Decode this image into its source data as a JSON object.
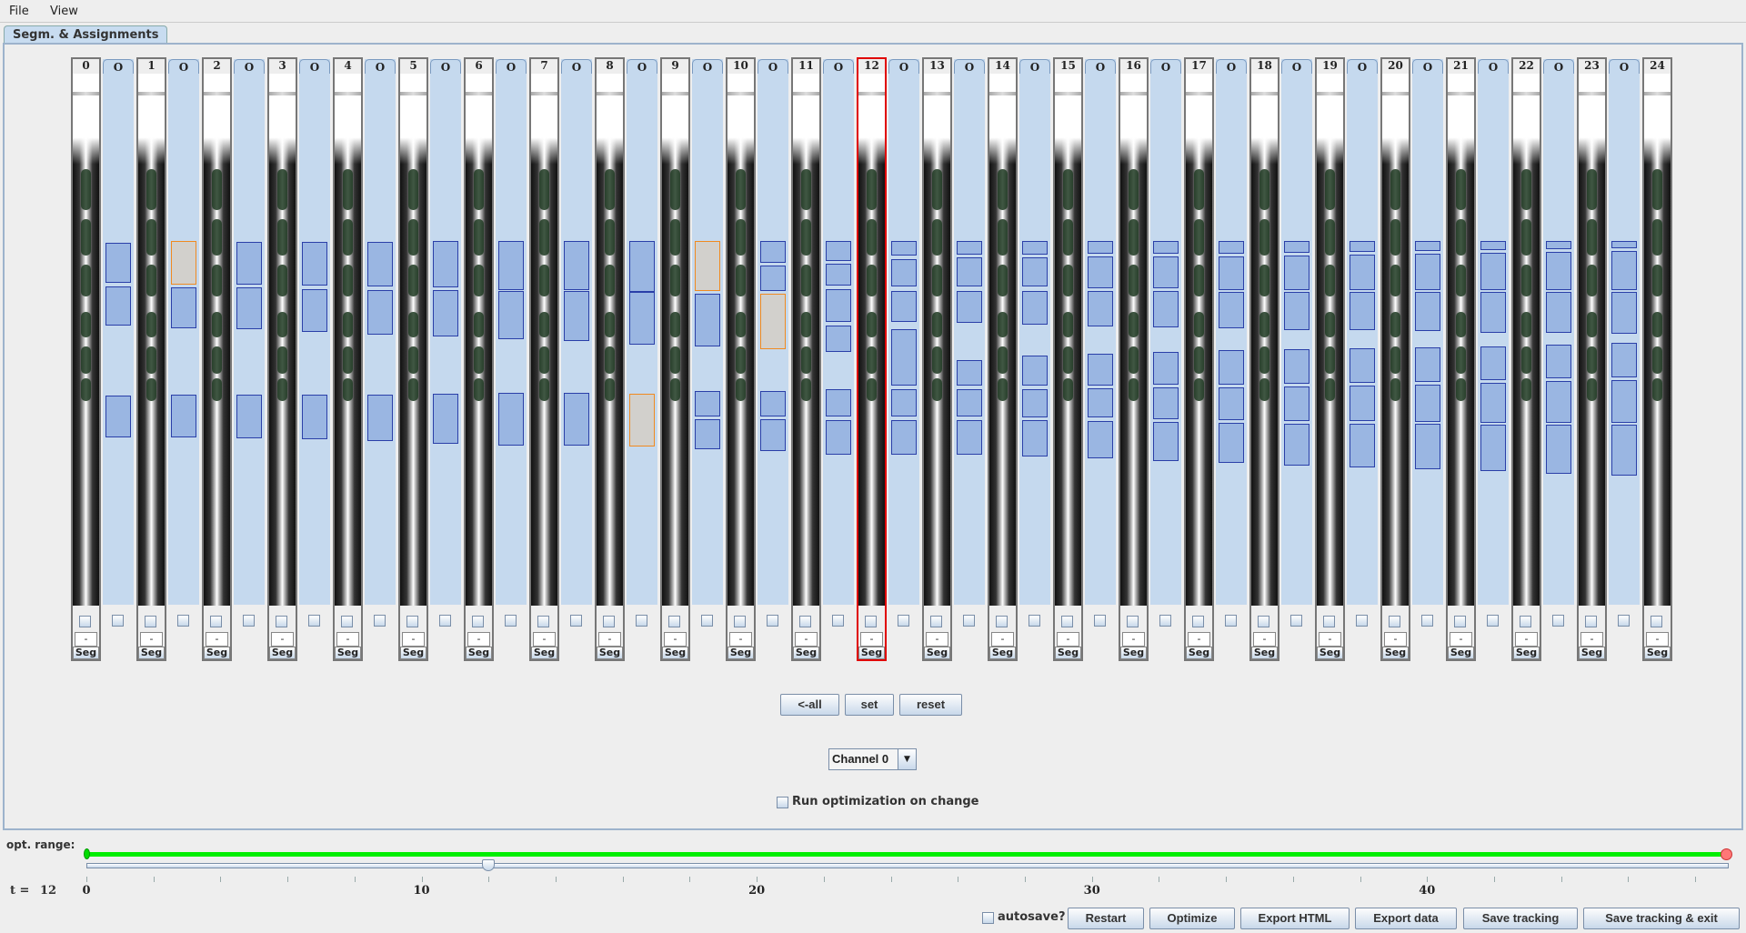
{
  "menu": {
    "file": "File",
    "view": "View"
  },
  "tab": {
    "label": "Segm. & Assignments"
  },
  "frames": {
    "labels": [
      "0",
      "1",
      "2",
      "3",
      "4",
      "5",
      "6",
      "7",
      "8",
      "9",
      "10",
      "11",
      "12",
      "13",
      "14",
      "15",
      "16",
      "17",
      "18",
      "19",
      "20",
      "21",
      "22",
      "23",
      "24"
    ],
    "selected": "12",
    "gap_label": "O",
    "minus_label": "-",
    "seg_label": "Seg"
  },
  "controls": {
    "all_label": "<-all",
    "set_label": "set",
    "reset_label": "reset",
    "channel": "Channel 0",
    "run_opt_label": "Run optimization on change",
    "run_opt_checked": false
  },
  "timeline": {
    "opt_range_label": "opt. range:",
    "t_label": "t =",
    "t_value": "12",
    "min": 0,
    "max": 49,
    "value": 12,
    "range": [
      0,
      49
    ],
    "tick_labels": [
      "0",
      "10",
      "20",
      "30",
      "40"
    ],
    "range_color": "#00ee00"
  },
  "footer": {
    "autosave_label": "autosave?",
    "autosave_checked": false,
    "restart": "Restart",
    "optimize": "Optimize",
    "export_html": "Export HTML",
    "export_data": "Export data",
    "save_tracking": "Save tracking",
    "save_exit": "Save tracking & exit"
  },
  "colors": {
    "segment": "#9ab6e2",
    "segment_border": "#2a3fa8",
    "conflict": "#f08a20",
    "selected_frame": "#e00000"
  }
}
